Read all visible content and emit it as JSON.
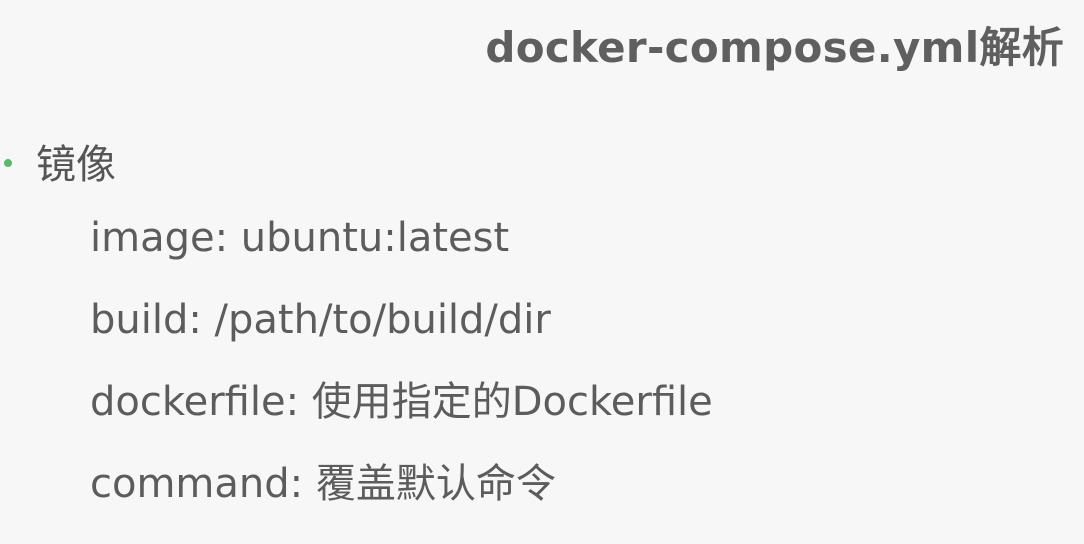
{
  "title": "docker-compose.yml解析",
  "section": {
    "bullet_label": "镜像",
    "bullet_color": "#59b86b",
    "lines": [
      "image: ubuntu:latest",
      "build: /path/to/build/dir",
      "dockerfile: 使用指定的Dockerfile",
      "command: 覆盖默认命令"
    ]
  }
}
